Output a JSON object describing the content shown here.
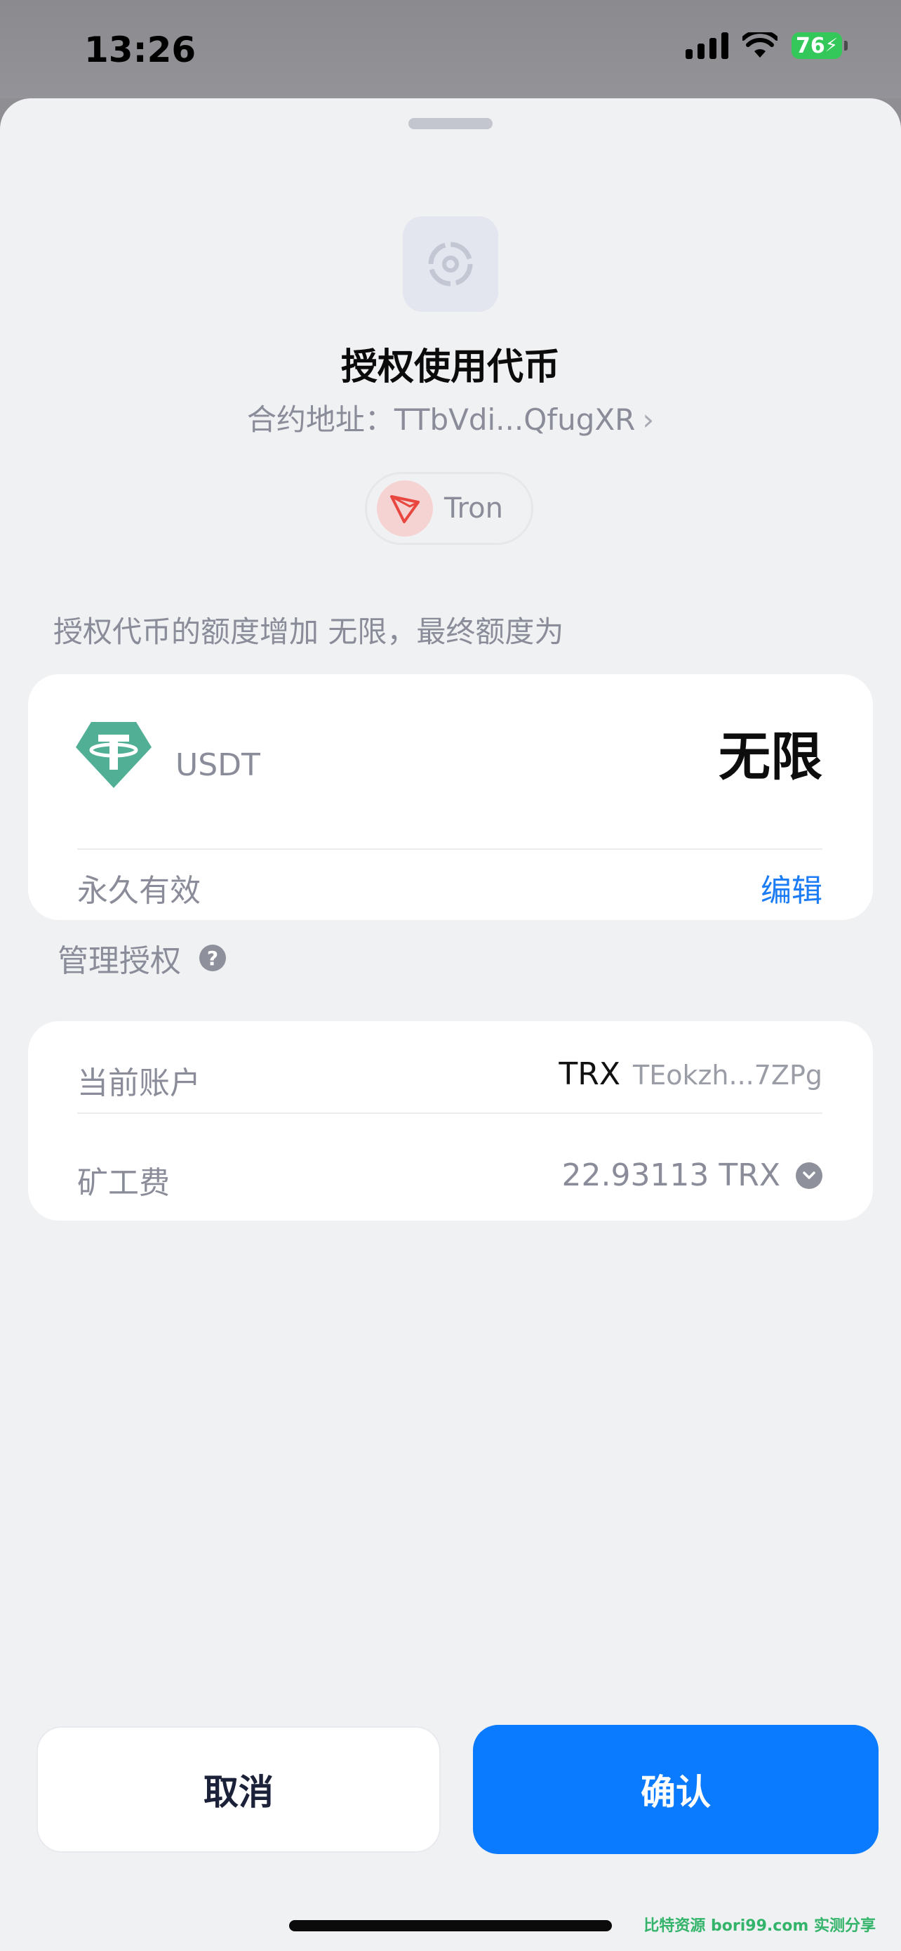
{
  "status_bar": {
    "time": "13:26",
    "battery": "76"
  },
  "header": {
    "title": "授权使用代币",
    "contract_label": "合约地址：",
    "contract_address": "TTbVdi...QfugXR",
    "chain": "Tron"
  },
  "description": "授权代币的额度增加 无限，最终额度为",
  "approval": {
    "token": "USDT",
    "amount": "无限",
    "validity": "永久有效",
    "edit_label": "编辑"
  },
  "manage_label": "管理授权",
  "details": {
    "account_label": "当前账户",
    "account_chain": "TRX",
    "account_address": "TEokzh...7ZPg",
    "fee_label": "矿工费",
    "fee_value": "22.93113 TRX"
  },
  "actions": {
    "cancel": "取消",
    "confirm": "确认"
  },
  "watermark": "比特资源 bori99.com 实测分享",
  "colors": {
    "accent": "#0a7bff",
    "token": "#50af95",
    "tron": "#e8463f",
    "battery": "#34c759"
  }
}
